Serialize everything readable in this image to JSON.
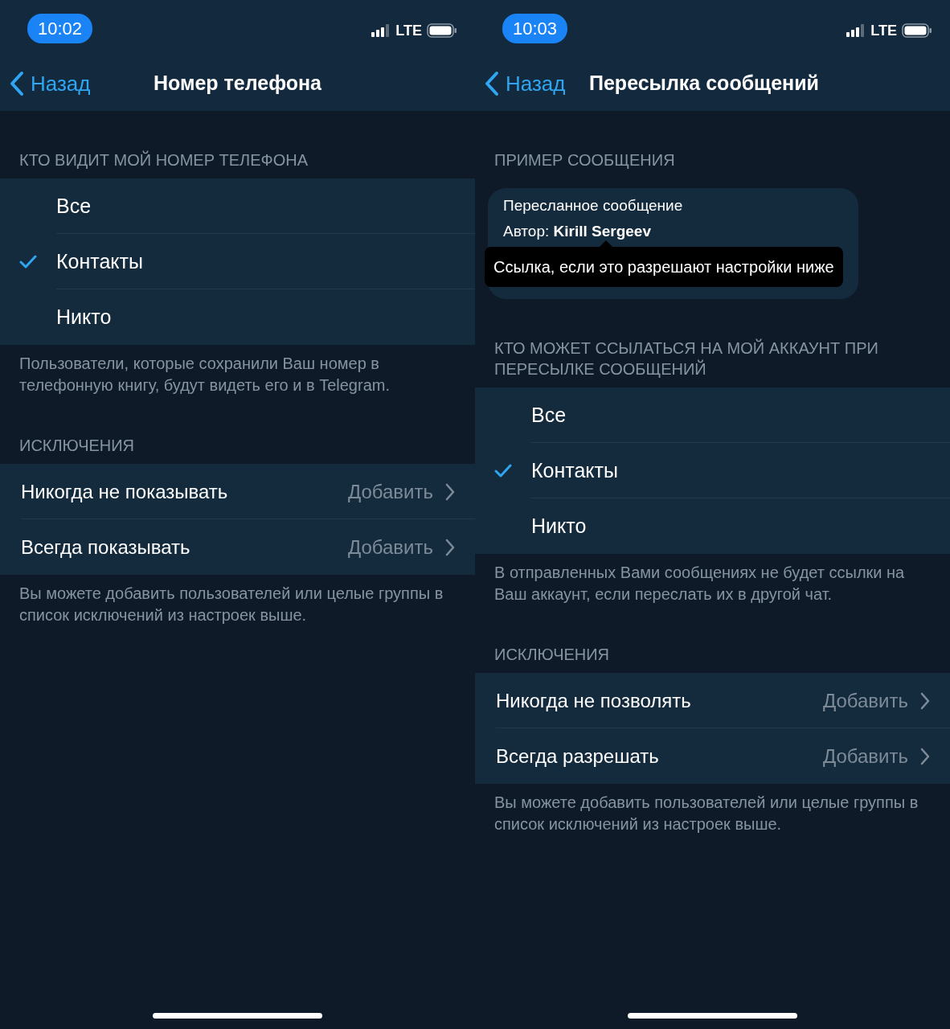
{
  "screens": [
    {
      "status_bar": {
        "time": "10:02",
        "network": "LTE"
      },
      "nav": {
        "back": "Назад",
        "title": "Номер телефона"
      },
      "sections": [
        {
          "kind": "options",
          "header": "КТО ВИДИТ МОЙ НОМЕР ТЕЛЕФОНА",
          "options": [
            {
              "label": "Все",
              "selected": false
            },
            {
              "label": "Контакты",
              "selected": true
            },
            {
              "label": "Никто",
              "selected": false
            }
          ],
          "footer": "Пользователи, которые сохранили Ваш номер в телефонную книгу, будут видеть его и в Telegram."
        },
        {
          "kind": "links",
          "header": "ИСКЛЮЧЕНИЯ",
          "items": [
            {
              "label": "Никогда не показывать",
              "value": "Добавить"
            },
            {
              "label": "Всегда показывать",
              "value": "Добавить"
            }
          ],
          "footer": "Вы можете добавить пользователей или целые группы в список исключений из настроек выше."
        }
      ]
    },
    {
      "status_bar": {
        "time": "10:03",
        "network": "LTE"
      },
      "nav": {
        "back": "Назад",
        "title": "Пересылка сообщений"
      },
      "sections": [
        {
          "kind": "preview",
          "header": "ПРИМЕР СООБЩЕНИЯ",
          "forwarded_label": "Пересланное сообщение",
          "author_line": "Автор: **Kirill Sergeev**",
          "tooltip": "Ссылка, если это разрешают настройки ниже"
        },
        {
          "kind": "options",
          "header": "КТО МОЖЕТ ССЫЛАТЬСЯ НА МОЙ АККАУНТ ПРИ ПЕРЕСЫЛКЕ СООБЩЕНИЙ",
          "options": [
            {
              "label": "Все",
              "selected": false
            },
            {
              "label": "Контакты",
              "selected": true
            },
            {
              "label": "Никто",
              "selected": false
            }
          ],
          "footer": "В отправленных Вами сообщениях не будет ссылки на Ваш аккаунт, если переслать их в другой чат."
        },
        {
          "kind": "links",
          "header": "ИСКЛЮЧЕНИЯ",
          "items": [
            {
              "label": "Никогда не позволять",
              "value": "Добавить"
            },
            {
              "label": "Всегда разрешать",
              "value": "Добавить"
            }
          ],
          "footer": "Вы можете добавить пользователей или целые группы в список исключений из настроек выше."
        }
      ]
    }
  ]
}
